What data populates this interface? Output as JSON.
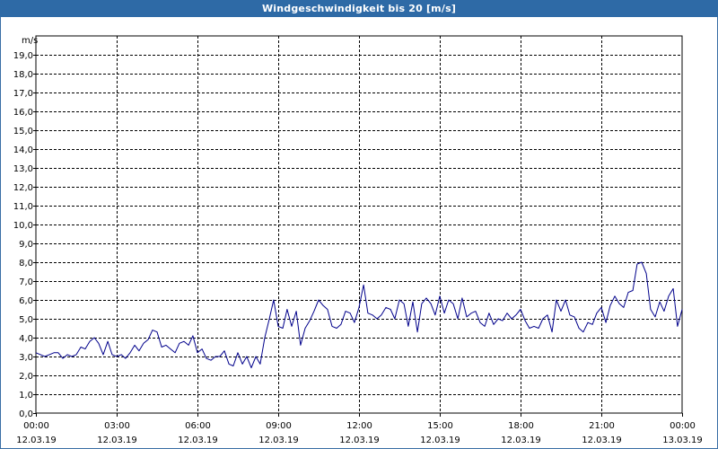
{
  "window": {
    "title": "Windgeschwindigkeit bis 20 [m/s]"
  },
  "colors": {
    "titlebar": "#2e6aa6",
    "line": "#00008b",
    "grid": "#000000",
    "background": "#ffffff"
  },
  "chart_data": {
    "type": "line",
    "title": "Windgeschwindigkeit bis 20 [m/s]",
    "ylabel": "m/s",
    "xlabel": "",
    "ylim": [
      0,
      20
    ],
    "xlim_hours": [
      0,
      24
    ],
    "grid": true,
    "y_ticks": [
      "0,0",
      "1,0",
      "2,0",
      "3,0",
      "4,0",
      "5,0",
      "6,0",
      "7,0",
      "8,0",
      "9,0",
      "10,0",
      "11,0",
      "12,0",
      "13,0",
      "14,0",
      "15,0",
      "16,0",
      "17,0",
      "18,0",
      "19,0"
    ],
    "x_ticks": [
      {
        "time": "00:00",
        "date": "12.03.19"
      },
      {
        "time": "03:00",
        "date": "12.03.19"
      },
      {
        "time": "06:00",
        "date": "12.03.19"
      },
      {
        "time": "09:00",
        "date": "12.03.19"
      },
      {
        "time": "12:00",
        "date": "12.03.19"
      },
      {
        "time": "15:00",
        "date": "12.03.19"
      },
      {
        "time": "18:00",
        "date": "12.03.19"
      },
      {
        "time": "21:00",
        "date": "12.03.19"
      },
      {
        "time": "00:00",
        "date": "13.03.19"
      }
    ],
    "series": [
      {
        "x_hours": [
          0.0,
          0.17,
          0.33,
          0.5,
          0.67,
          0.83,
          1.0,
          1.17,
          1.33,
          1.5,
          1.67,
          1.83,
          2.0,
          2.17,
          2.33,
          2.5,
          2.67,
          2.83,
          3.0,
          3.17,
          3.33,
          3.5,
          3.67,
          3.83,
          4.0,
          4.17,
          4.33,
          4.5,
          4.67,
          4.83,
          5.0,
          5.17,
          5.33,
          5.5,
          5.67,
          5.83,
          6.0,
          6.17,
          6.33,
          6.5,
          6.67,
          6.83,
          7.0,
          7.17,
          7.33,
          7.5,
          7.67,
          7.83,
          8.0,
          8.17,
          8.33,
          8.5,
          8.67,
          8.83,
          9.0,
          9.17,
          9.33,
          9.5,
          9.67,
          9.83,
          10.0,
          10.17,
          10.33,
          10.5,
          10.67,
          10.83,
          11.0,
          11.17,
          11.33,
          11.5,
          11.67,
          11.83,
          12.0,
          12.17,
          12.33,
          12.5,
          12.67,
          12.83,
          13.0,
          13.17,
          13.33,
          13.5,
          13.67,
          13.83,
          14.0,
          14.17,
          14.33,
          14.5,
          14.67,
          14.83,
          15.0,
          15.17,
          15.33,
          15.5,
          15.67,
          15.83,
          16.0,
          16.17,
          16.33,
          16.5,
          16.67,
          16.83,
          17.0,
          17.17,
          17.33,
          17.5,
          17.67,
          17.83,
          18.0,
          18.17,
          18.33,
          18.5,
          18.67,
          18.83,
          19.0,
          19.17,
          19.33,
          19.5,
          19.67,
          19.83,
          20.0,
          20.17,
          20.33,
          20.5,
          20.67,
          20.83,
          21.0,
          21.17,
          21.33,
          21.5,
          21.67,
          21.83,
          22.0,
          22.17,
          22.33,
          22.5,
          22.67,
          22.83,
          23.0,
          23.17,
          23.33,
          23.5,
          23.67,
          23.83,
          24.0
        ],
        "values": [
          3.2,
          3.1,
          3.0,
          3.1,
          3.2,
          3.2,
          2.9,
          3.1,
          3.0,
          3.1,
          3.5,
          3.4,
          3.8,
          4.0,
          3.7,
          3.1,
          3.8,
          3.1,
          3.0,
          3.1,
          2.9,
          3.2,
          3.6,
          3.3,
          3.7,
          3.9,
          4.4,
          4.3,
          3.5,
          3.6,
          3.4,
          3.2,
          3.7,
          3.8,
          3.6,
          4.1,
          3.2,
          3.4,
          2.9,
          2.8,
          3.0,
          3.0,
          3.3,
          2.6,
          2.5,
          3.2,
          2.6,
          3.0,
          2.4,
          3.0,
          2.6,
          4.0,
          5.0,
          6.0,
          4.6,
          4.5,
          5.5,
          4.6,
          5.4,
          3.6,
          4.5,
          4.9,
          5.4,
          6.0,
          5.7,
          5.5,
          4.6,
          4.5,
          4.7,
          5.4,
          5.3,
          4.8,
          5.6,
          6.8,
          5.3,
          5.2,
          5.0,
          5.2,
          5.6,
          5.5,
          5.0,
          6.0,
          5.8,
          4.6,
          5.9,
          4.3,
          5.8,
          6.1,
          5.8,
          5.2,
          6.2,
          5.3,
          6.0,
          5.8,
          5.0,
          6.1,
          5.1,
          5.3,
          5.4,
          4.8,
          4.6,
          5.3,
          4.7,
          5.0,
          4.9,
          5.3,
          5.0,
          5.2,
          5.5,
          4.9,
          4.5,
          4.6,
          4.5,
          5.0,
          5.2,
          4.3,
          6.0,
          5.4,
          6.0,
          5.2,
          5.1,
          4.5,
          4.3,
          4.8,
          4.7,
          5.3,
          5.6,
          4.8,
          5.7,
          6.2,
          5.8,
          5.6,
          6.4,
          6.5,
          7.9,
          8.0,
          7.4,
          5.5,
          5.1,
          5.9,
          5.4,
          6.2,
          6.6,
          4.6,
          5.5
        ]
      }
    ]
  }
}
